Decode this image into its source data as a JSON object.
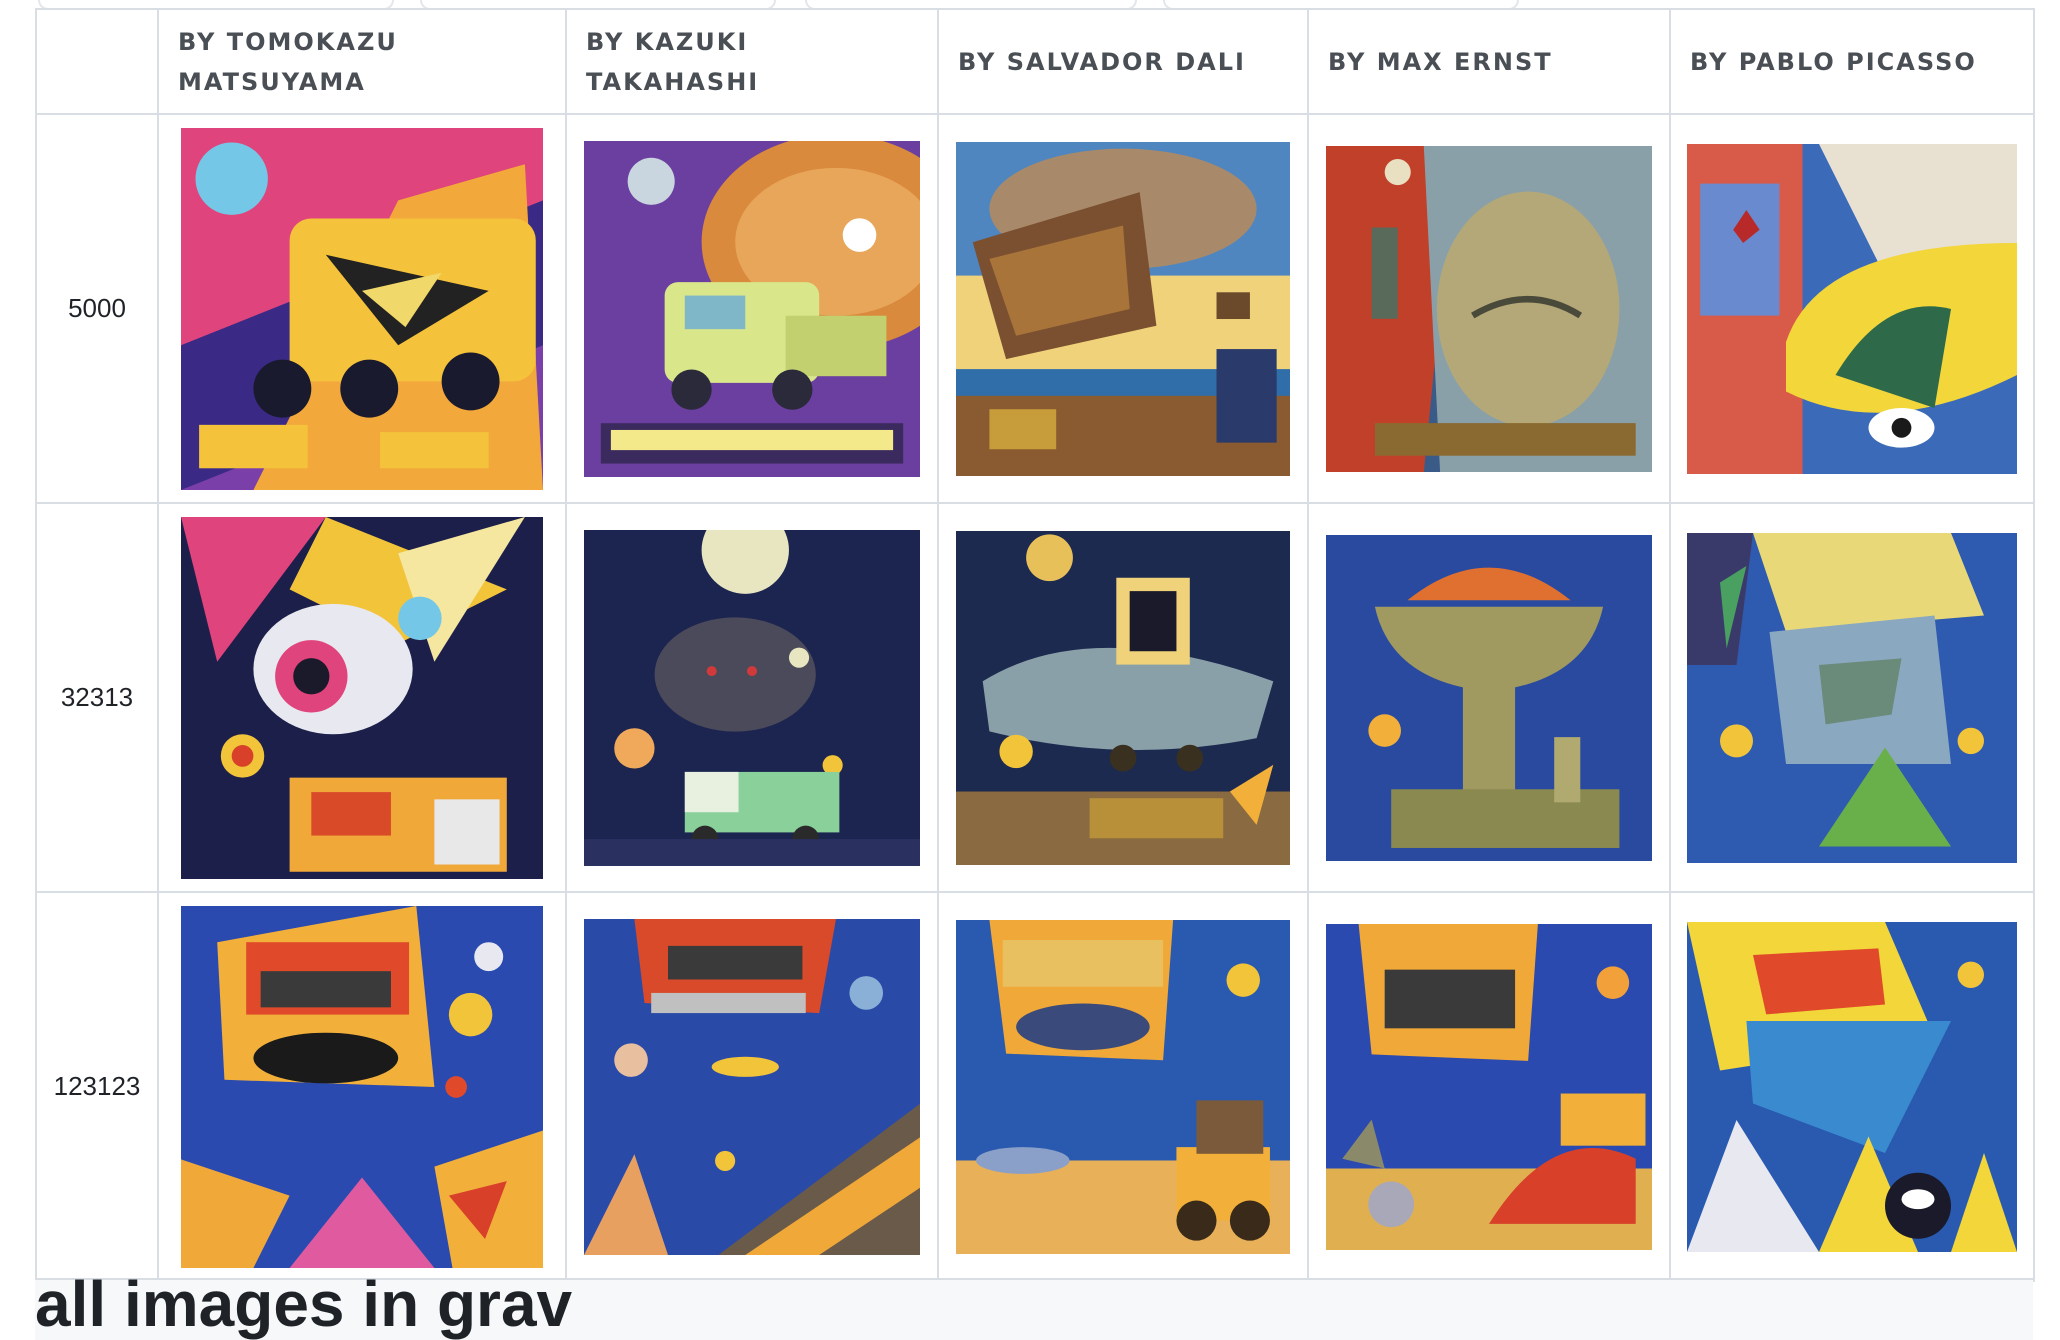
{
  "table": {
    "columns": [
      {
        "label": ""
      },
      {
        "label": "BY TOMOKAZU MATSUYAMA"
      },
      {
        "label": "BY KAZUKI TAKAHASHI"
      },
      {
        "label": "BY SALVADOR DALI"
      },
      {
        "label": "BY MAX ERNST"
      },
      {
        "label": "BY PABLO PICASSO"
      }
    ],
    "rows": [
      {
        "seed": "5000"
      },
      {
        "seed": "32313"
      },
      {
        "seed": "123123"
      }
    ]
  },
  "bottom_heading": "all images in grav",
  "colors": {
    "border": "#d8dee4",
    "header_text": "#4a4f55",
    "body_text": "#1f2328"
  }
}
